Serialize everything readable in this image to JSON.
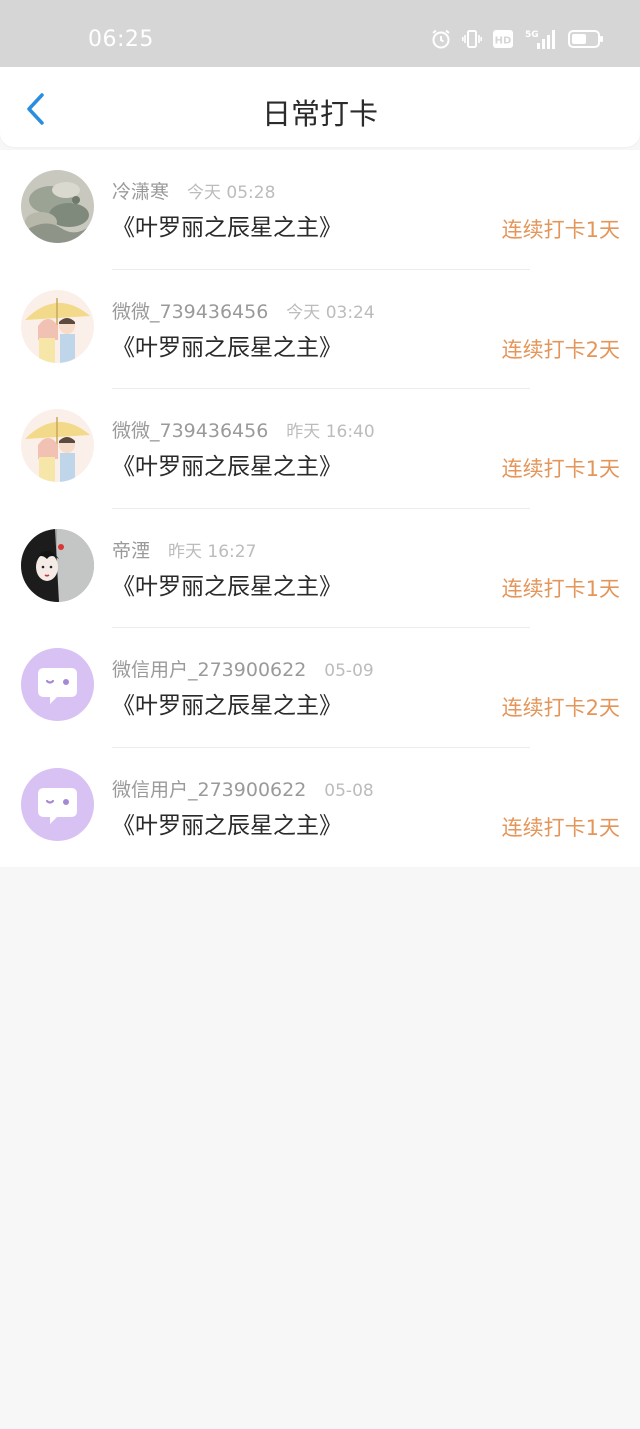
{
  "status_bar": {
    "time": "06:25",
    "icons": [
      "alarm-icon",
      "vibrate-icon",
      "hd-icon",
      "5g-signal-icon",
      "battery-icon"
    ],
    "hd_label": "HD",
    "network_label": "5G"
  },
  "header": {
    "title": "日常打卡",
    "back_icon": "chevron-left-icon",
    "accent_color": "#2a8ee0"
  },
  "records": [
    {
      "user": "冷潇寒",
      "time": "今天 05:28",
      "book": "《叶罗丽之辰星之主》",
      "streak": "连续打卡1天",
      "avatar": "landscape-painting"
    },
    {
      "user": "微微_739436456",
      "time": "今天 03:24",
      "book": "《叶罗丽之辰星之主》",
      "streak": "连续打卡2天",
      "avatar": "couple-umbrella"
    },
    {
      "user": "微微_739436456",
      "time": "昨天 16:40",
      "book": "《叶罗丽之辰星之主》",
      "streak": "连续打卡1天",
      "avatar": "couple-umbrella"
    },
    {
      "user": "帝湮",
      "time": "昨天 16:27",
      "book": "《叶罗丽之辰星之主》",
      "streak": "连续打卡1天",
      "avatar": "ancient-girl"
    },
    {
      "user": "微信用户_273900622",
      "time": "05-09",
      "book": "《叶罗丽之辰星之主》",
      "streak": "连续打卡2天",
      "avatar": "wechat-default"
    },
    {
      "user": "微信用户_273900622",
      "time": "05-08",
      "book": "《叶罗丽之辰星之主》",
      "streak": "连续打卡1天",
      "avatar": "wechat-default"
    }
  ],
  "colors": {
    "streak": "#e4965a",
    "username": "#9a9a9a",
    "timestamp": "#bcbcbc",
    "default_avatar": "#d7c2f3"
  }
}
